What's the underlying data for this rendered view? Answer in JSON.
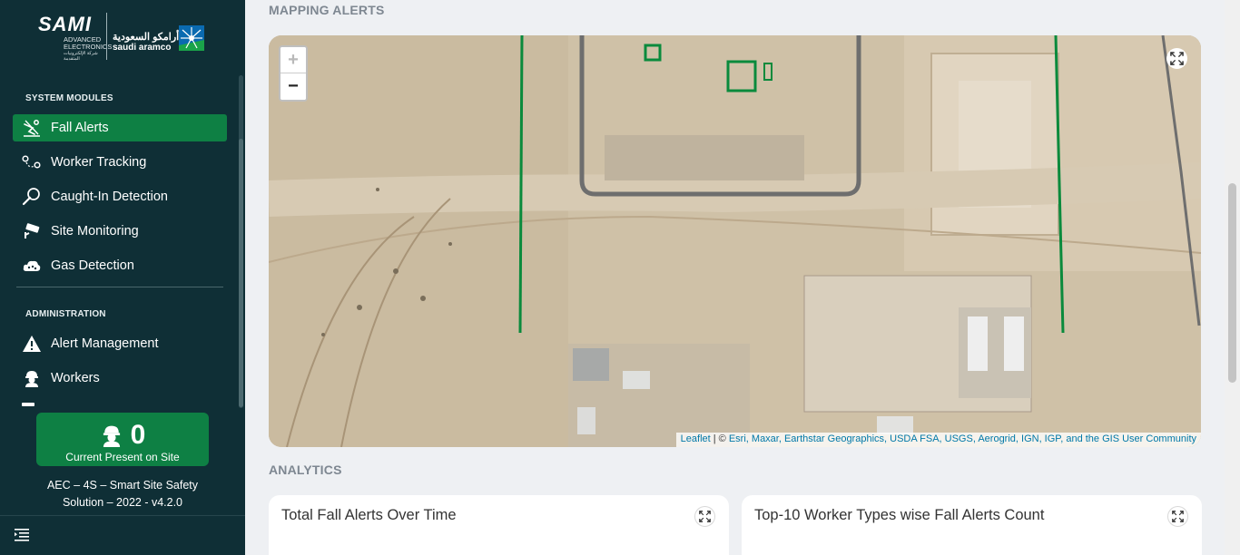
{
  "brand": {
    "sami_name": "SAMI",
    "sami_sub_1": "ADVANCED",
    "sami_sub_2": "ELECTRONICS",
    "sami_sub_ar": "شركة الإلكترونيات المتقدمة",
    "aramco_ar": "أرامكو السعودية",
    "aramco_en": "saudi aramco"
  },
  "sidebar": {
    "system_modules_title": "SYSTEM MODULES",
    "modules": [
      {
        "label": "Fall Alerts",
        "icon": "fall-alert-icon",
        "active": true
      },
      {
        "label": "Worker Tracking",
        "icon": "route-pin-icon",
        "active": false
      },
      {
        "label": "Caught-In Detection",
        "icon": "magnifier-icon",
        "active": false
      },
      {
        "label": "Site Monitoring",
        "icon": "cctv-camera-icon",
        "active": false
      },
      {
        "label": "Gas Detection",
        "icon": "gas-cloud-icon",
        "active": false
      }
    ],
    "administration_title": "ADMINISTRATION",
    "admin": [
      {
        "label": "Alert Management",
        "icon": "warning-icon"
      },
      {
        "label": "Workers",
        "icon": "worker-helmet-icon"
      }
    ],
    "present": {
      "count": "0",
      "label": "Current Present on Site",
      "icon": "worker-helmet-icon"
    },
    "version_line_1": "AEC – 4S – Smart Site Safety",
    "version_line_2": "Solution – 2022 - v4.2.0"
  },
  "main": {
    "mapping_title": "MAPPING ALERTS",
    "map": {
      "zoom_in": "+",
      "zoom_out": "−",
      "attribution_leaflet": "Leaflet",
      "attribution_sep": " | © ",
      "attribution_sources": "Esri, Maxar, Earthstar Geographics, USDA FSA, USGS, Aerogrid, IGN, IGP, and the GIS User Community"
    },
    "analytics_title": "ANALYTICS",
    "cards": [
      {
        "title": "Total Fall Alerts Over Time"
      },
      {
        "title": "Top-10 Worker Types wise Fall Alerts Count"
      }
    ]
  },
  "colors": {
    "sidebar_bg": "#0f2f36",
    "accent_green": "#0e8044",
    "map_fence_green": "#0a8a3c"
  }
}
